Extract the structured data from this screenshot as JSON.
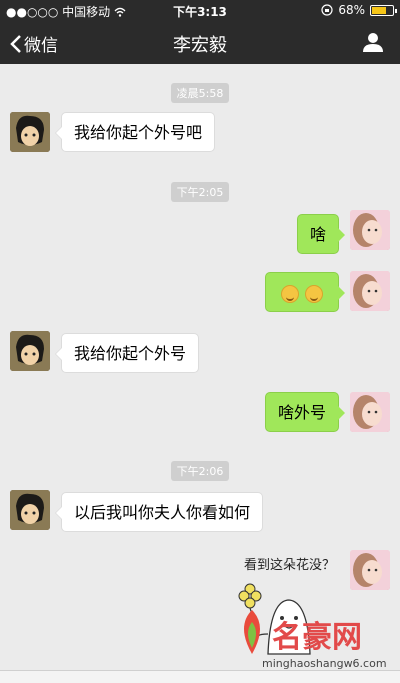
{
  "status_bar": {
    "carrier": "●●○○○ 中国移动",
    "wifi_icon": "wifi-icon",
    "time": "下午3:13",
    "lock_icon": "rotation-lock-icon",
    "battery_percent": "68%",
    "battery_level": 0.68
  },
  "nav": {
    "back_label": "微信",
    "title": "李宏毅",
    "profile_icon": "person-icon"
  },
  "messages": [
    {
      "type": "time",
      "text": "凌晨5:58"
    },
    {
      "type": "text",
      "side": "left",
      "text": "我给你起个外号吧"
    },
    {
      "type": "time",
      "text": "下午2:05"
    },
    {
      "type": "text",
      "side": "right",
      "text": "啥"
    },
    {
      "type": "emoji",
      "side": "right",
      "emoji_count": 2
    },
    {
      "type": "text",
      "side": "left",
      "text": "我给你起个外号"
    },
    {
      "type": "text",
      "side": "right",
      "text": "啥外号"
    },
    {
      "type": "time",
      "text": "下午2:06"
    },
    {
      "type": "text",
      "side": "left",
      "text": "以后我叫你夫人你看如何"
    },
    {
      "type": "sticker",
      "side": "right",
      "text": "看到这朵花没？"
    }
  ],
  "watermark": {
    "name": "名豪网",
    "url": "minghaoshangw6.com"
  },
  "colors": {
    "nav_bg": "#2b2b2b",
    "chat_bg": "#ebebeb",
    "right_bubble": "#a0e75a",
    "left_bubble": "#ffffff"
  }
}
